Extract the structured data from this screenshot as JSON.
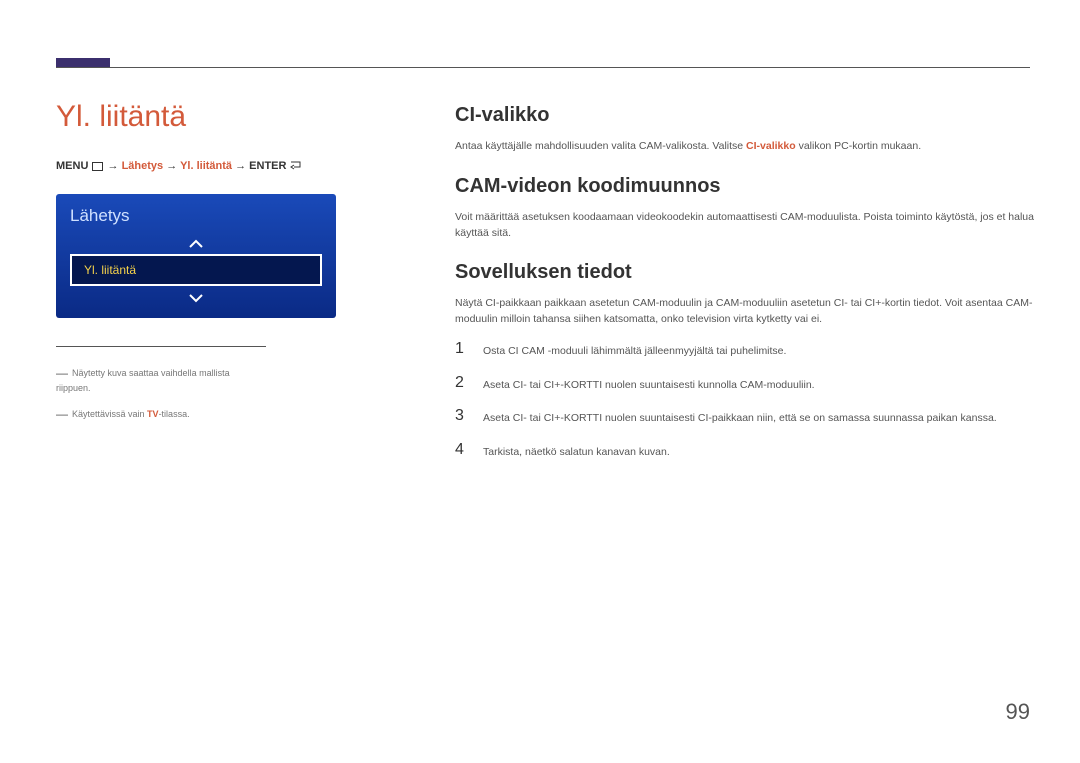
{
  "left": {
    "title": "Yl. liitäntä",
    "breadcrumb": {
      "menu": "MENU",
      "path1": "Lähetys",
      "path2": "Yl. liitäntä",
      "enter": "ENTER"
    },
    "tvmenu": {
      "title": "Lähetys",
      "selected": "Yl. liitäntä"
    },
    "footnotes": {
      "n1": "Näytetty kuva saattaa vaihdella mallista riippuen.",
      "n2_a": "Käytettävissä vain ",
      "n2_red": "TV",
      "n2_b": "-tilassa."
    }
  },
  "right": {
    "s1": {
      "h": "CI-valikko",
      "p_a": "Antaa käyttäjälle mahdollisuuden valita CAM-valikosta. Valitse ",
      "p_red": "CI-valikko",
      "p_b": " valikon PC-kortin mukaan."
    },
    "s2": {
      "h": "CAM-videon koodimuunnos",
      "p": "Voit määrittää asetuksen koodaamaan videokoodekin automaattisesti CAM-moduulista. Poista toiminto käytöstä, jos et halua käyttää sitä."
    },
    "s3": {
      "h": "Sovelluksen tiedot",
      "p": "Näytä CI-paikkaan paikkaan asetetun CAM-moduulin ja CAM-moduuliin asetetun CI- tai CI+-kortin tiedot. Voit asentaa CAM-moduulin milloin tahansa siihen katsomatta, onko television virta kytketty vai ei.",
      "steps": [
        {
          "n": "1",
          "t": "Osta CI CAM -moduuli lähimmältä jälleenmyyjältä tai puhelimitse."
        },
        {
          "n": "2",
          "t": "Aseta CI- tai CI+-KORTTI nuolen suuntaisesti kunnolla CAM-moduuliin."
        },
        {
          "n": "3",
          "t": "Aseta CI- tai CI+-KORTTI nuolen suuntaisesti CI-paikkaan niin, että se on samassa suunnassa paikan kanssa."
        },
        {
          "n": "4",
          "t": "Tarkista, näetkö salatun kanavan kuvan."
        }
      ]
    }
  },
  "page": "99"
}
